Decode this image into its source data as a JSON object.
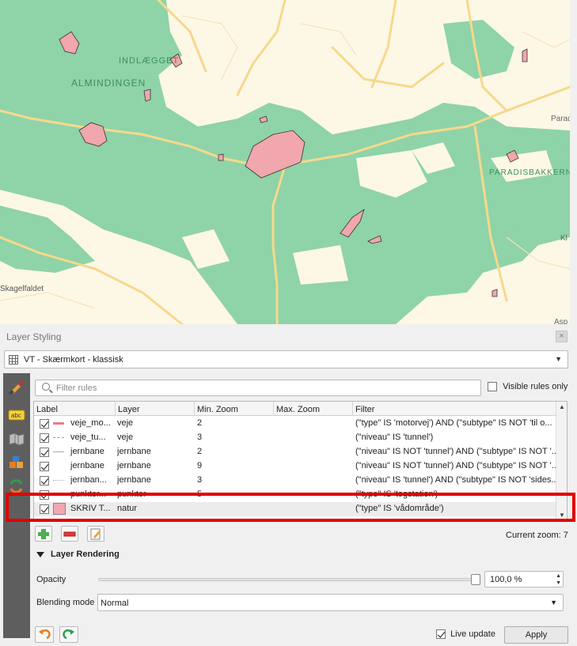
{
  "map": {
    "labels": {
      "almindingen": "ALMINDINGEN",
      "indlaegget": "INDLÆGGET",
      "paradisbakkerne": "PARADISBAKKERNE",
      "skagelfaldet": "Skagelfaldet",
      "parad": "Parad",
      "kl": "Kl",
      "asp": "Asp"
    },
    "colors": {
      "forest": "#8fd3a8",
      "land": "#fdf7e6",
      "wetland": "#f2a6ae",
      "road": "#f5d98b"
    }
  },
  "panel": {
    "title": "Layer Styling",
    "close_glyph": "×",
    "layer_combo": "VT - Skærmkort - klassisk",
    "filter_placeholder": "Filter rules",
    "visible_rules_only": "Visible rules only",
    "columns": [
      "Label",
      "Layer",
      "Min. Zoom",
      "Max. Zoom",
      "Filter"
    ],
    "rows": [
      {
        "label": "veje_mo...",
        "layer": "veje",
        "min": "2",
        "max": "",
        "filter": "(\"type\" IS 'motorvej') AND (\"subtype\" IS NOT 'til o...",
        "checked": true,
        "symbol": "red-line"
      },
      {
        "label": "veje_tu...",
        "layer": "veje",
        "min": "3",
        "max": "",
        "filter": "(\"niveau\" IS 'tunnel')",
        "checked": true,
        "symbol": "dash-line"
      },
      {
        "label": "jernbane",
        "layer": "jernbane",
        "min": "2",
        "max": "",
        "filter": "(\"niveau\" IS NOT 'tunnel') AND (\"subtype\" IS NOT '...",
        "checked": true,
        "symbol": "gray-line"
      },
      {
        "label": "jernbane",
        "layer": "jernbane",
        "min": "9",
        "max": "",
        "filter": "(\"niveau\" IS NOT 'tunnel') AND (\"subtype\" IS NOT '...",
        "checked": true,
        "symbol": "none"
      },
      {
        "label": "jernban...",
        "layer": "jernbane",
        "min": "3",
        "max": "",
        "filter": "(\"niveau\" IS 'tunnel') AND (\"subtype\" IS NOT 'sides...",
        "checked": true,
        "symbol": "dot-line"
      },
      {
        "label": "punkter...",
        "layer": "punkter",
        "min": "5",
        "max": "",
        "filter": "(\"type\" IS 'togstation')",
        "checked": true,
        "symbol": "point"
      },
      {
        "label": "SKRIV T...",
        "layer": "natur",
        "min": "",
        "max": "",
        "filter": "(\"type\" IS 'vådområde')",
        "checked": true,
        "symbol": "pink-fill"
      }
    ],
    "current_zoom": "Current zoom: 7",
    "layer_rendering": "Layer Rendering",
    "opacity_label": "Opacity",
    "opacity_value": "100,0 %",
    "opacity_level": 1.0,
    "blending_label": "Blending mode",
    "blending_value": "Normal",
    "live_update": "Live update",
    "apply": "Apply"
  }
}
